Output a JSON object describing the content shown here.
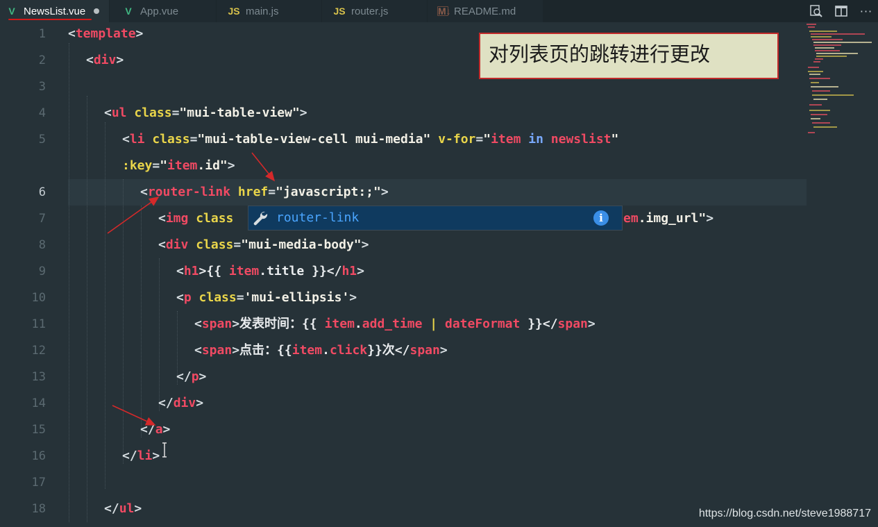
{
  "tabs": [
    {
      "label": "NewsList.vue",
      "icon": "vue-icon",
      "active": true,
      "dirty": true
    },
    {
      "label": "App.vue",
      "icon": "vue-icon"
    },
    {
      "label": "main.js",
      "icon": "js-icon"
    },
    {
      "label": "router.js",
      "icon": "js-icon"
    },
    {
      "label": "README.md",
      "icon": "md-icon"
    }
  ],
  "icon_glyphs": {
    "js": "JS",
    "md": "M↓",
    "info": "i",
    "more": "···"
  },
  "toolbar": [
    "find-in-files-icon",
    "split-editor-icon",
    "more-actions-icon"
  ],
  "line_numbers": [
    "1",
    "2",
    "3",
    "4",
    "5",
    "",
    "6",
    "7",
    "8",
    "9",
    "10",
    "11",
    "12",
    "13",
    "14",
    "15",
    "16",
    "17",
    "18"
  ],
  "code": {
    "l1": [
      "<",
      "template",
      ">"
    ],
    "l2": [
      "<",
      "div",
      ">"
    ],
    "l4": [
      "<",
      "ul",
      " ",
      "class",
      "=",
      "\"mui-table-view\"",
      ">"
    ],
    "l5": [
      "<",
      "li",
      " ",
      "class",
      "=",
      "\"mui-table-view-cell mui-media\"",
      " ",
      "v-for",
      "=",
      "\"",
      "item",
      " in ",
      "newslist",
      "\""
    ],
    "l5b": [
      ":key",
      "=",
      "\"",
      "item",
      ".id\"",
      ">"
    ],
    "l6": [
      "<",
      "router-link",
      " ",
      "href",
      "=",
      "\"javascript:;\"",
      ">"
    ],
    "l7a": [
      "<",
      "img",
      " ",
      "class"
    ],
    "l7b": [
      "em",
      ".img_url\"",
      ">"
    ],
    "l8": [
      "<",
      "div",
      " ",
      "class",
      "=",
      "\"mui-media-body\"",
      ">"
    ],
    "l9": [
      "<",
      "h1",
      ">{{ ",
      "item",
      ".title }}</",
      "h1",
      ">"
    ],
    "l10": [
      "<",
      "p",
      " ",
      "class",
      "=",
      "'mui-ellipsis'",
      ">"
    ],
    "l11": [
      "<",
      "span",
      ">",
      "发表时间：{{ ",
      "item",
      ".",
      "add_time",
      " | ",
      "dateFormat",
      " }}</",
      "span",
      ">"
    ],
    "l12": [
      "<",
      "span",
      ">",
      "点击：{{",
      "item",
      ".",
      "click",
      "}}次</",
      "span",
      ">"
    ],
    "l13": [
      "</",
      "p",
      ">"
    ],
    "l14": [
      "</",
      "div",
      ">"
    ],
    "l15": [
      "</",
      "a",
      ">"
    ],
    "l16": [
      "</",
      "li",
      ">"
    ],
    "l18": [
      "</",
      "ul",
      ">"
    ]
  },
  "autocomplete": {
    "suggestion": "router-link",
    "icon": "wrench-icon",
    "info": "info-icon"
  },
  "annotation": "对列表页的跳转进行更改",
  "watermark": "https://blog.csdn.net/steve1988717",
  "colors": {
    "background": "#263238",
    "tag": "#f04a63",
    "attribute": "#e9d54a",
    "string": "#f2f0e6",
    "annotation_border": "#c22a2a",
    "annotation_fill": "#dfe1c3",
    "suggest_highlight": "#0f3a5f"
  }
}
